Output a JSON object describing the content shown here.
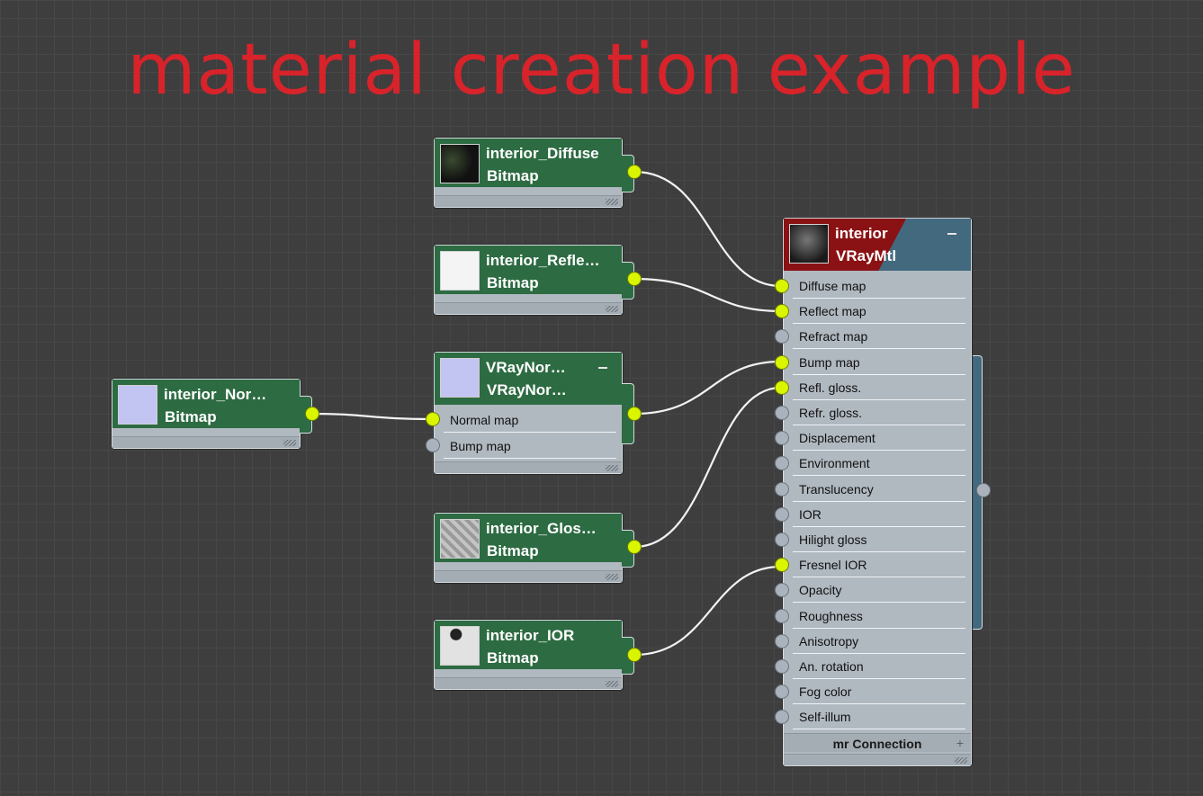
{
  "title": "material creation example",
  "colors": {
    "title": "#d8232a",
    "bitmap_header": "#2d6b42",
    "material_header": "#42697e",
    "connected_socket": "#d9f500"
  },
  "nodes": {
    "diffuse": {
      "name": "interior_Diffuse",
      "type": "Bitmap"
    },
    "reflect": {
      "name": "interior_Refle…",
      "type": "Bitmap"
    },
    "normal_bitmap": {
      "name": "interior_Nor…",
      "type": "Bitmap"
    },
    "vray_normal": {
      "name": "VRayNor…",
      "type": "VRayNor…",
      "slots": [
        "Normal map",
        "Bump map"
      ]
    },
    "gloss": {
      "name": "interior_Glos…",
      "type": "Bitmap"
    },
    "ior": {
      "name": "interior_IOR",
      "type": "Bitmap"
    }
  },
  "material": {
    "name": "interior",
    "type": "VRayMtl",
    "slots": [
      "Diffuse map",
      "Reflect map",
      "Refract map",
      "Bump map",
      "Refl. gloss.",
      "Refr. gloss.",
      "Displacement",
      "Environment",
      "Translucency",
      "IOR",
      "Hilight gloss",
      "Fresnel IOR",
      "Opacity",
      "Roughness",
      "Anisotropy",
      "An. rotation",
      "Fog color",
      "Self-illum"
    ],
    "connected_slots": [
      "Diffuse map",
      "Reflect map",
      "Bump map",
      "Refl. gloss.",
      "Fresnel IOR"
    ],
    "footer": "mr Connection"
  }
}
